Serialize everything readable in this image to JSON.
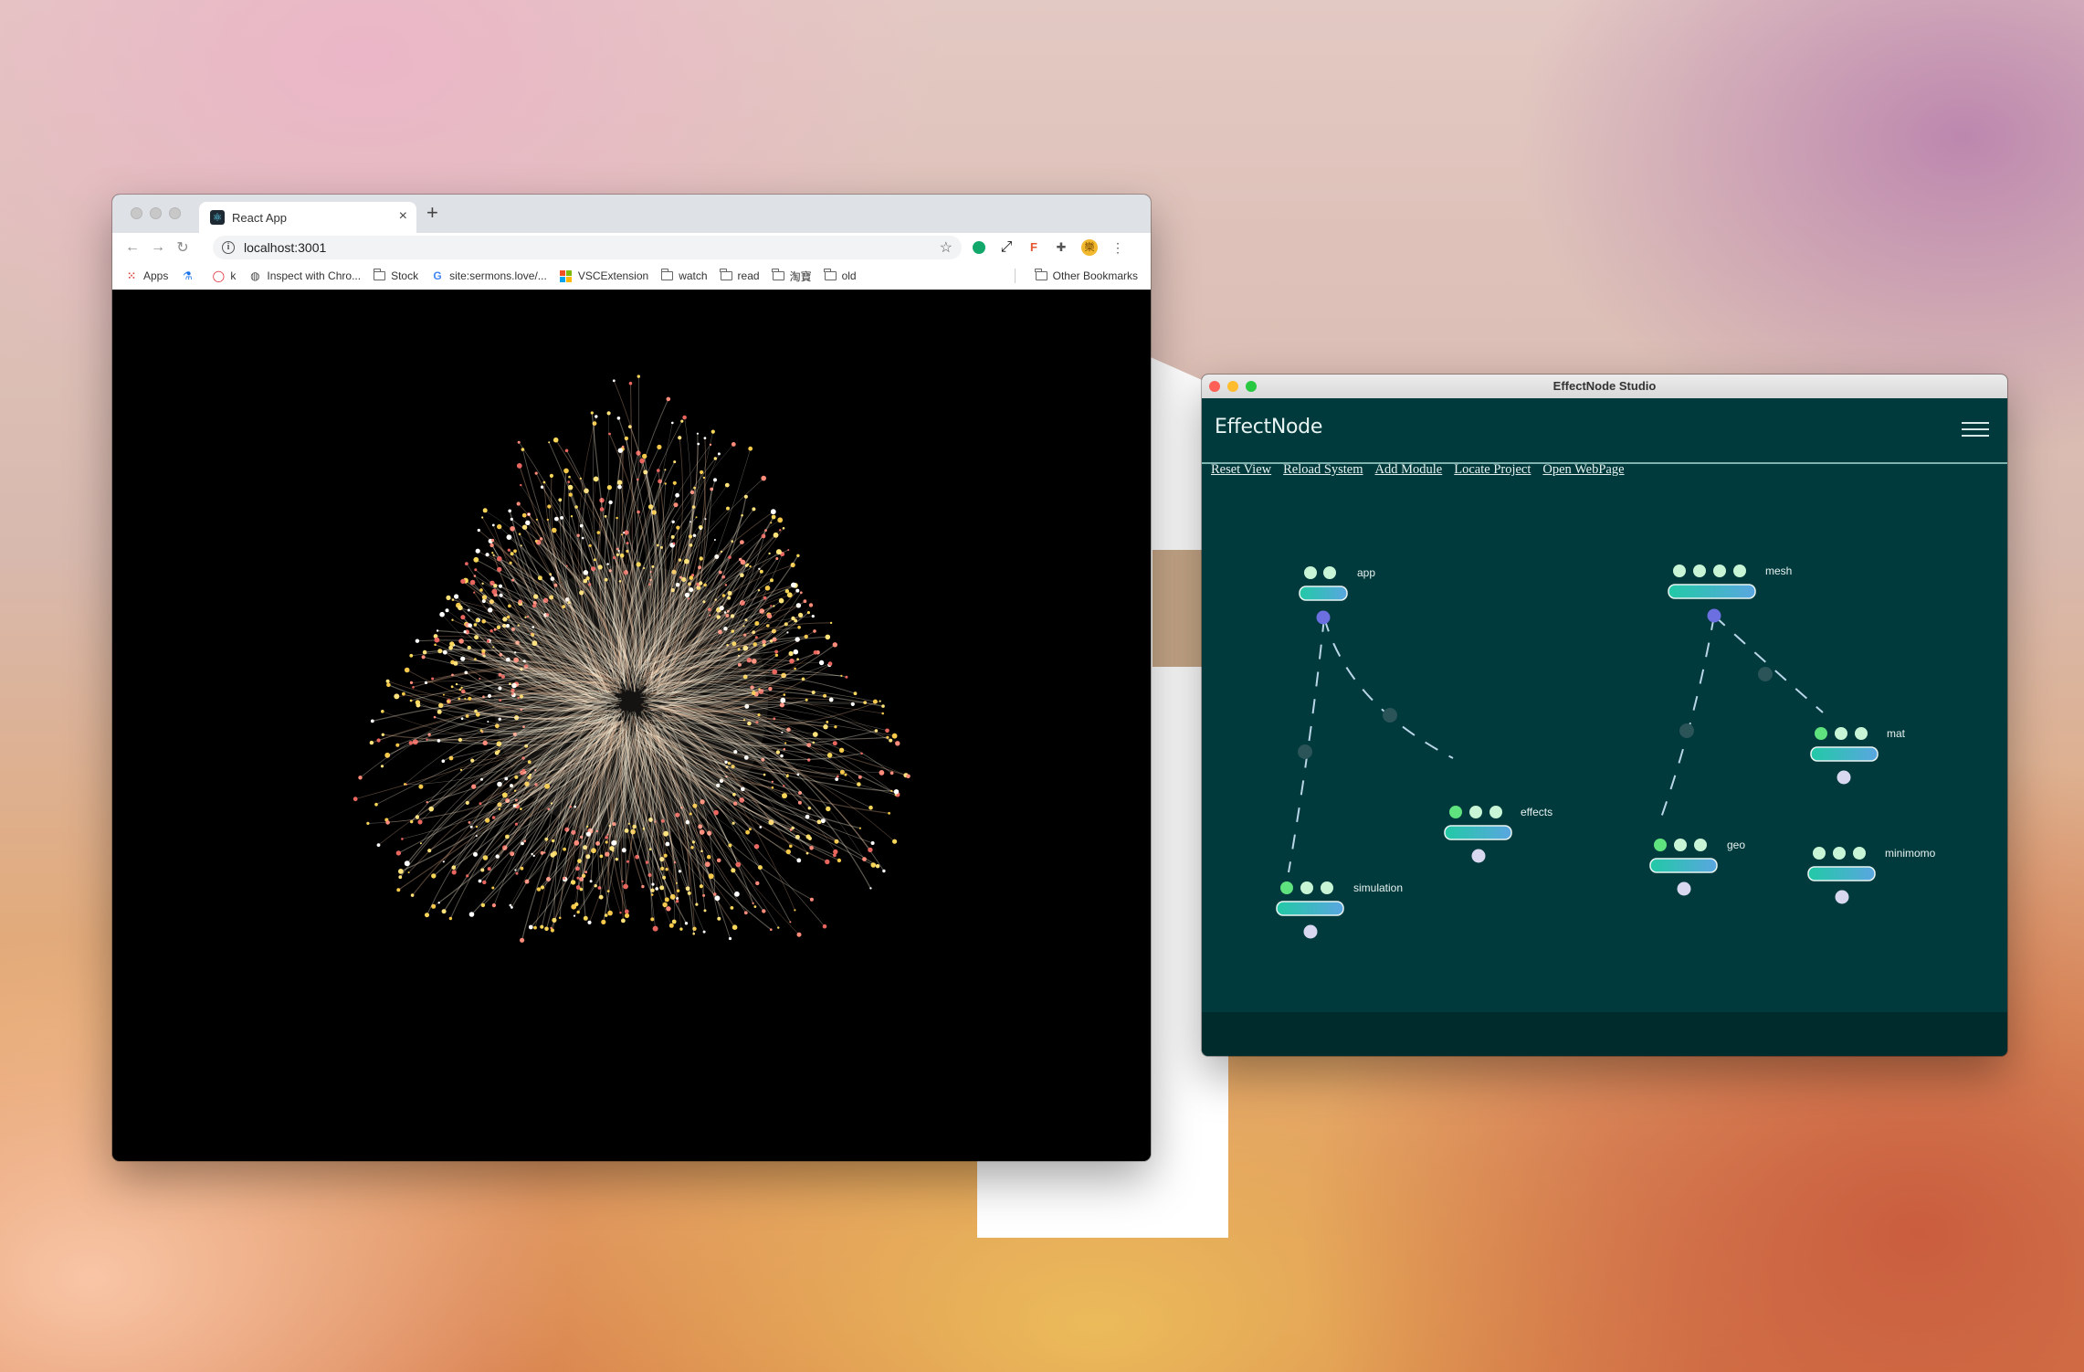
{
  "browser": {
    "tab_title": "React App",
    "tab_close": "×",
    "new_tab": "+",
    "url": "localhost:3001",
    "nav": {
      "back": "←",
      "forward": "→",
      "reload": "↻"
    },
    "bookmarks": [
      {
        "label": "Apps",
        "icon": "apps-grid-icon"
      },
      {
        "label": "",
        "icon": "flask-icon"
      },
      {
        "label": "k",
        "icon": "opera-icon"
      },
      {
        "label": "Inspect with Chro...",
        "icon": "globe-icon"
      },
      {
        "label": "Stock",
        "icon": "folder-icon"
      },
      {
        "label": "site:sermons.love/...",
        "icon": "google-icon"
      },
      {
        "label": "VSCExtension",
        "icon": "microsoft-icon"
      },
      {
        "label": "watch",
        "icon": "folder-icon"
      },
      {
        "label": "read",
        "icon": "folder-icon"
      },
      {
        "label": "淘寶",
        "icon": "folder-icon"
      },
      {
        "label": "old",
        "icon": "folder-icon"
      }
    ],
    "other_bookmarks": "Other Bookmarks"
  },
  "studio": {
    "window_title": "EffectNode Studio",
    "brand": "EffectNode",
    "menu": [
      "Reset View",
      "Reload System",
      "Add Module",
      "Locate Project",
      "Open WebPage"
    ],
    "nodes": [
      {
        "label": "app"
      },
      {
        "label": "mesh"
      },
      {
        "label": "effects"
      },
      {
        "label": "simulation"
      },
      {
        "label": "mat"
      },
      {
        "label": "geo"
      },
      {
        "label": "minimomo"
      }
    ]
  },
  "colors": {
    "studio_bg": "#003a3c",
    "node_in": "#c8f5d6",
    "node_in_active": "#5ee37f",
    "node_out": "#d8d8f0",
    "node_out_active": "#6b6fe0",
    "bar_from": "#22c9a6",
    "bar_to": "#5aa6e0"
  }
}
